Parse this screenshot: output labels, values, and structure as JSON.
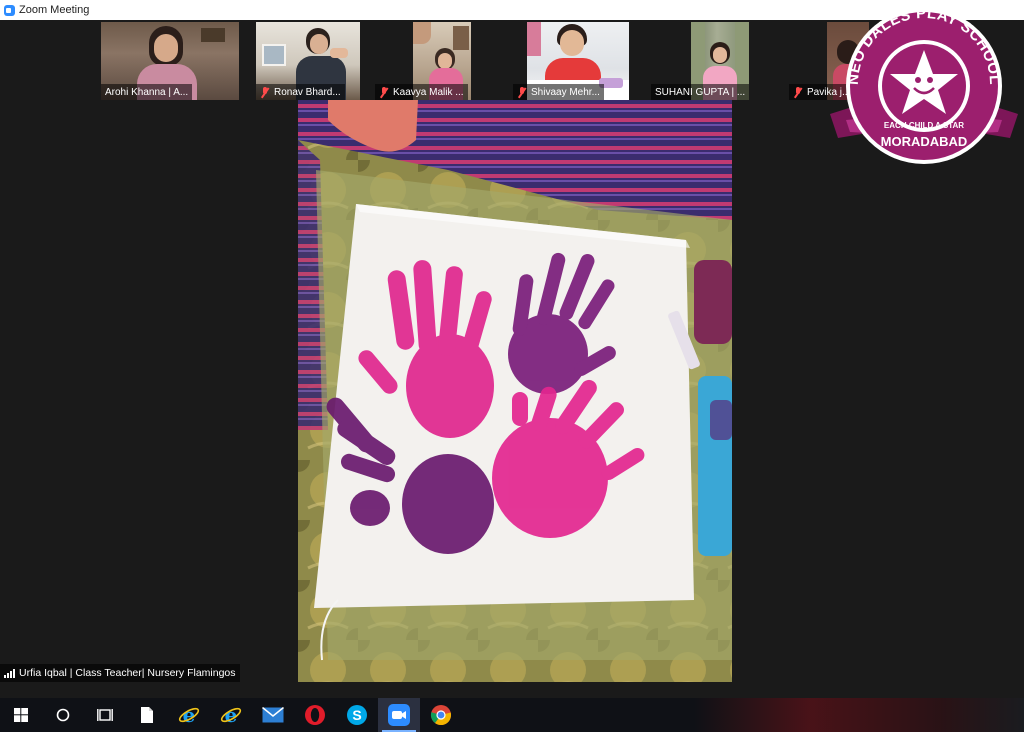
{
  "window": {
    "title": "Zoom Meeting"
  },
  "participants": [
    {
      "name": "Arohi Khanna | A...",
      "muted": false
    },
    {
      "name": "Ronav Bhard...",
      "muted": true
    },
    {
      "name": "Kaavya Malik ...",
      "muted": true
    },
    {
      "name": "Shivaay Mehr...",
      "muted": true
    },
    {
      "name": "SUHANI GUPTA | ...",
      "muted": false
    },
    {
      "name": "Pavika j...",
      "muted": true
    }
  ],
  "active_speaker": {
    "name": "Urfia Iqbal | Class Teacher| Nursery Flamingos"
  },
  "logo": {
    "top_text": "NEO DALES PLAY SCHOOL",
    "tagline": "EACH CHILD A STAR",
    "city": "MORADABAD",
    "color": "#9c1f6e"
  },
  "taskbar": {
    "items": [
      {
        "name": "windows-start",
        "icon": "windows-logo-icon"
      },
      {
        "name": "search",
        "icon": "search-circle-icon"
      },
      {
        "name": "task-view",
        "icon": "task-view-icon"
      },
      {
        "name": "file",
        "icon": "document-icon"
      },
      {
        "name": "internet-explorer-1",
        "icon": "internet-explorer-icon"
      },
      {
        "name": "internet-explorer-2",
        "icon": "internet-explorer-icon"
      },
      {
        "name": "mail",
        "icon": "mail-icon"
      },
      {
        "name": "opera",
        "icon": "opera-icon"
      },
      {
        "name": "skype",
        "icon": "skype-icon"
      },
      {
        "name": "zoom",
        "icon": "zoom-icon"
      },
      {
        "name": "chrome",
        "icon": "chrome-icon"
      }
    ]
  }
}
